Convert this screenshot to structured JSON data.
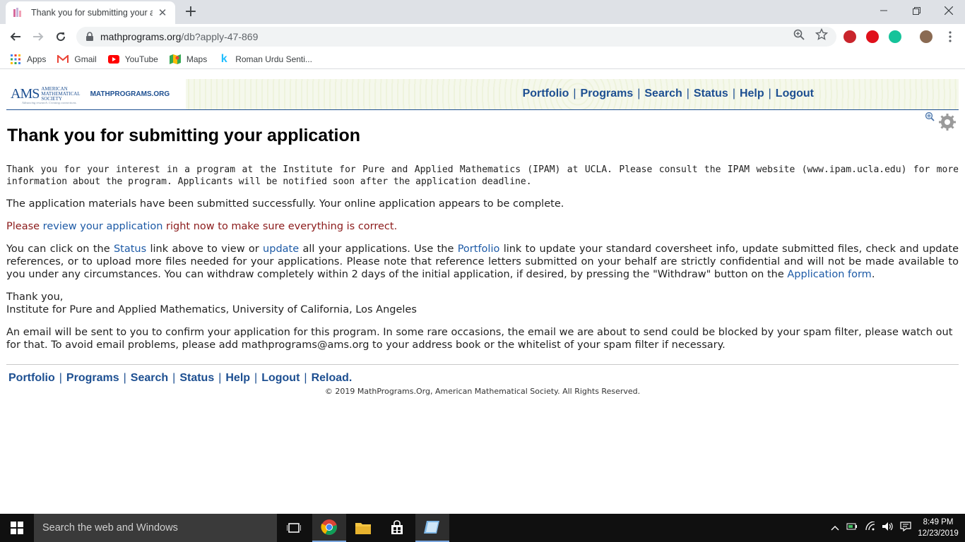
{
  "browser": {
    "tab_title": "Thank you for submitting your ap",
    "url_domain": "mathprograms.org",
    "url_path": "/db?apply-47-869",
    "bookmarks": [
      {
        "label": "Apps",
        "icon": "apps-grid-icon"
      },
      {
        "label": "Gmail",
        "icon": "gmail-icon"
      },
      {
        "label": "YouTube",
        "icon": "youtube-icon"
      },
      {
        "label": "Maps",
        "icon": "maps-icon"
      },
      {
        "label": "Roman Urdu Senti...",
        "icon": "k-icon"
      }
    ]
  },
  "site": {
    "logo_text": "AMS",
    "logo_subtext": [
      "AMERICAN",
      "MATHEMATICAL",
      "SOCIETY"
    ],
    "logo_tagline": "Advancing research. Creating connections.",
    "site_name": "MATHPROGRAMS.ORG",
    "nav": [
      "Portfolio",
      "Programs",
      "Search",
      "Status",
      "Help",
      "Logout"
    ]
  },
  "main": {
    "title": "Thank you for submitting your application",
    "intro": "Thank you for your interest in a program at the Institute for Pure and Applied Mathematics (IPAM) at UCLA. Please consult the IPAM website (www.ipam.ucla.edu) for more information about the program. Applicants will be notified soon after the application deadline.",
    "success": "The application materials have been submitted successfully. Your online application appears to be complete.",
    "review_prefix": "Please ",
    "review_link": "review your application",
    "review_suffix": " right now to make sure everything is correct.",
    "info_1": "You can click on the ",
    "info_link_status": "Status",
    "info_2": " link above to view or ",
    "info_link_update": "update",
    "info_3": " all your applications. Use the ",
    "info_link_portfolio": "Portfolio",
    "info_4": " link to update your standard coversheet info, update submitted files, check and update references, or to upload more files needed for your applications. Please note that reference letters submitted on your behalf are strictly confidential and will not be made available to you under any circumstances. You can withdraw completely within 2 days of the initial application, if desired, by pressing the \"Withdraw\" button on the ",
    "info_link_form": "Application form",
    "info_5": ".",
    "thanks_line": "Thank you,",
    "signature": "Institute for Pure and Applied Mathematics, University of California, Los Angeles",
    "email_note": "An email will be sent to you to confirm your application for this program. In some rare occasions, the email we are about to send could be blocked by your spam filter, please watch out for that. To avoid email problems, please add mathprograms@ams.org to your address book or the whitelist of your spam filter if necessary."
  },
  "footer": {
    "nav": [
      "Portfolio",
      "Programs",
      "Search",
      "Status",
      "Help",
      "Logout",
      "Reload."
    ],
    "copyright": "© 2019 MathPrograms.Org, American Mathematical Society. All Rights Reserved."
  },
  "taskbar": {
    "search_placeholder": "Search the web and Windows",
    "time": "8:49 PM",
    "date": "12/23/2019"
  },
  "colors": {
    "link": "#1d5aa6",
    "nav": "#1d4f91",
    "warning": "#8b1a1a"
  }
}
